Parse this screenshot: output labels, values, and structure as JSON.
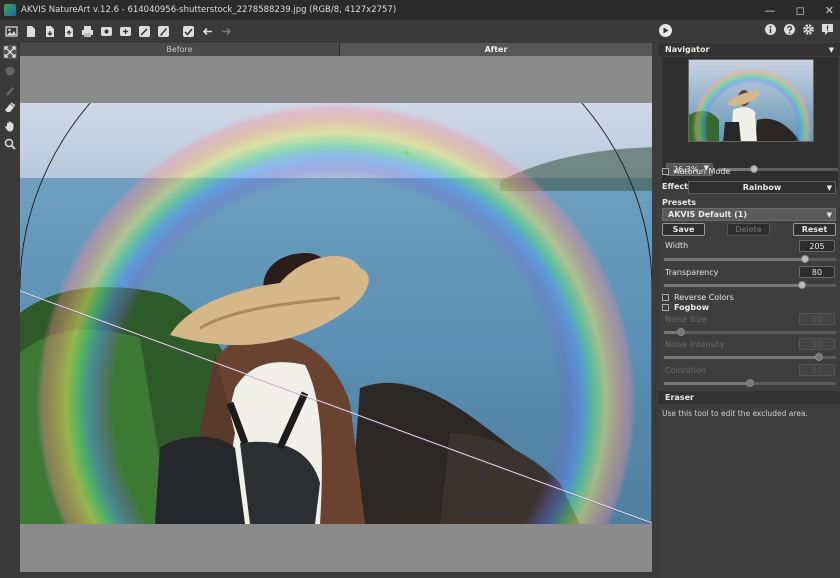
{
  "window": {
    "title": "AKVIS NatureArt v.12.6 - 614040956-shutterstock_2278588239.jpg (RGB/8, 4127x2757)",
    "buttons": [
      "minimize-icon",
      "maximize-icon",
      "close-icon"
    ]
  },
  "toolbar": {
    "left_icons": [
      "open-icon",
      "new-file-icon",
      "save-icon",
      "export-icon",
      "print-icon",
      "share-icon",
      "batch-icon",
      "selection-icon",
      "brush-icon",
      "check-icon",
      "undo-icon",
      "redo-icon"
    ],
    "run_icon": "play-icon",
    "right_icons": [
      "info-icon",
      "help-icon",
      "settings-icon",
      "feedback-icon"
    ]
  },
  "tools": [
    "crop-icon",
    "stroke-icon",
    "brush-icon",
    "eraser-icon",
    "hand-icon",
    "zoom-icon"
  ],
  "tabs": {
    "before": "Before",
    "after": "After"
  },
  "panel": {
    "navigator_title": "Navigator",
    "zoom": "26.3%",
    "zoom_level": 0.3,
    "autorun_label": "Autorun Mode",
    "effect_label": "Effect:",
    "effect_value": "Rainbow",
    "presets_title": "Presets",
    "preset_value": "AKVIS Default (1)",
    "save_label": "Save",
    "delete_label": "Delete",
    "reset_label": "Reset",
    "params": [
      {
        "label": "Width",
        "value": "205",
        "level": 0.82
      },
      {
        "label": "Transparency",
        "value": "80",
        "level": 0.8
      }
    ],
    "reverse_colors_label": "Reverse Colors",
    "fogbow_label": "Fogbow",
    "fog_params": [
      {
        "label": "Noise Size",
        "value": "50",
        "level": 0.1
      },
      {
        "label": "Noise Intensity",
        "value": "90",
        "level": 0.9
      },
      {
        "label": "Coloration",
        "value": "50",
        "level": 0.5
      }
    ],
    "eraser_title": "Eraser",
    "eraser_text": "Use this tool to edit the excluded area."
  }
}
